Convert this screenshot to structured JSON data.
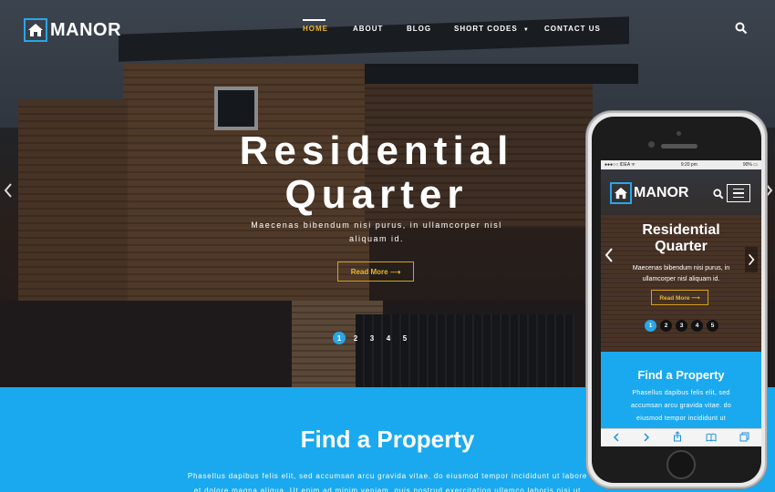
{
  "header": {
    "logo_text": "MANOR",
    "nav": [
      {
        "label": "HOME",
        "active": true
      },
      {
        "label": "ABOUT",
        "active": false
      },
      {
        "label": "BLOG",
        "active": false
      },
      {
        "label": "SHORT CODES",
        "active": false,
        "has_dropdown": true
      },
      {
        "label": "CONTACT US",
        "active": false
      }
    ]
  },
  "hero": {
    "title_line1": "Residential",
    "title_line2": "Quarter",
    "subtitle_line1": "Maecenas bibendum nisi purus, in ullamcorper nisl",
    "subtitle_line2": "aliquam id.",
    "button_label": "Read More ⟶",
    "slides": [
      "1",
      "2",
      "3",
      "4",
      "5"
    ],
    "active_slide": 1
  },
  "find": {
    "title": "Find a Property",
    "text_line1": "Phasellus dapibus felis elit, sed accumsan arcu gravida vitae. do eiusmod tempor incididunt ut labore",
    "text_line2": "et dolore magna aliqua. Ut enim ad minim veniam, quis nostrud exercitation ullamco laboris nisi ut"
  },
  "phone": {
    "status": {
      "carrier": "●●●○○ IDEA ᯤ",
      "time": "9:20 pm",
      "battery": "90% ▭"
    },
    "logo_text": "MANOR",
    "title_line1": "Residential",
    "title_line2": "Quarter",
    "subtitle_line1": "Maecenas bibendum nisi purus, in",
    "subtitle_line2": "ullamcorper nisl aliquam id.",
    "button_label": "Read More ⟶",
    "slides": [
      "1",
      "2",
      "3",
      "4",
      "5"
    ],
    "find_title": "Find a Property",
    "find_line1": "Phasellus dapibus felis elit, sed",
    "find_line2": "accumsan arcu gravida vitae. do",
    "find_line3": "eiusmod tempor incididunt ut"
  },
  "colors": {
    "accent": "#29a6e8",
    "gold": "#e8b830",
    "section_blue": "#1aa9ee"
  }
}
